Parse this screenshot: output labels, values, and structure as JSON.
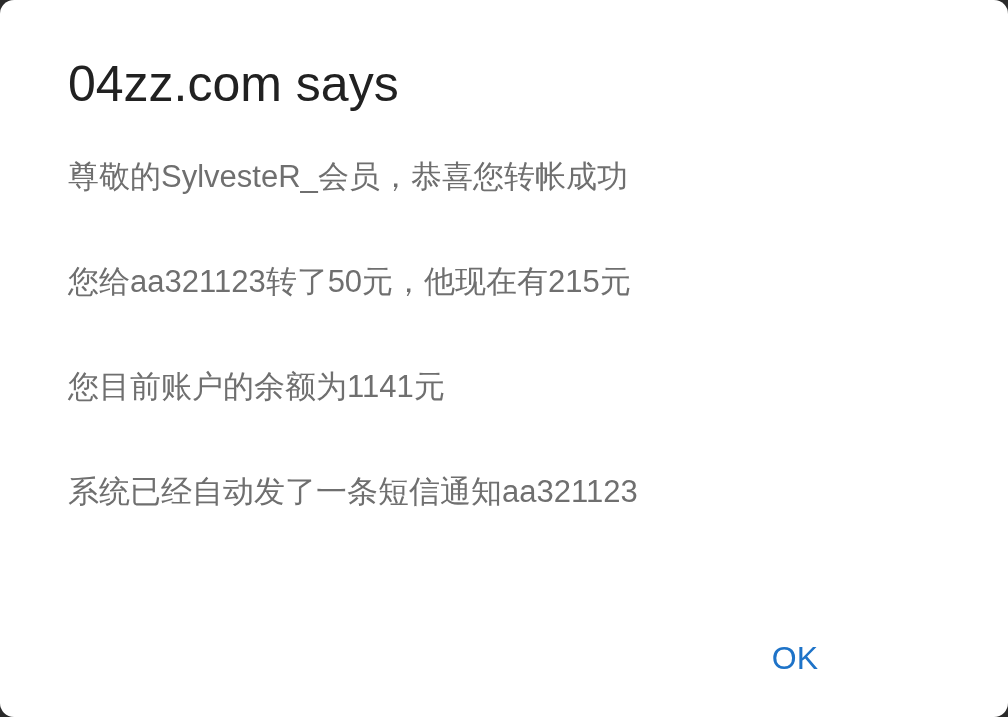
{
  "dialog": {
    "title": "04zz.com says",
    "messages": [
      "尊敬的SylvesteR_会员，恭喜您转帐成功",
      "您给aa321123转了50元，他现在有215元",
      "您目前账户的余额为1141元",
      "系统已经自动发了一条短信通知aa321123"
    ],
    "buttons": [
      "OK"
    ]
  }
}
